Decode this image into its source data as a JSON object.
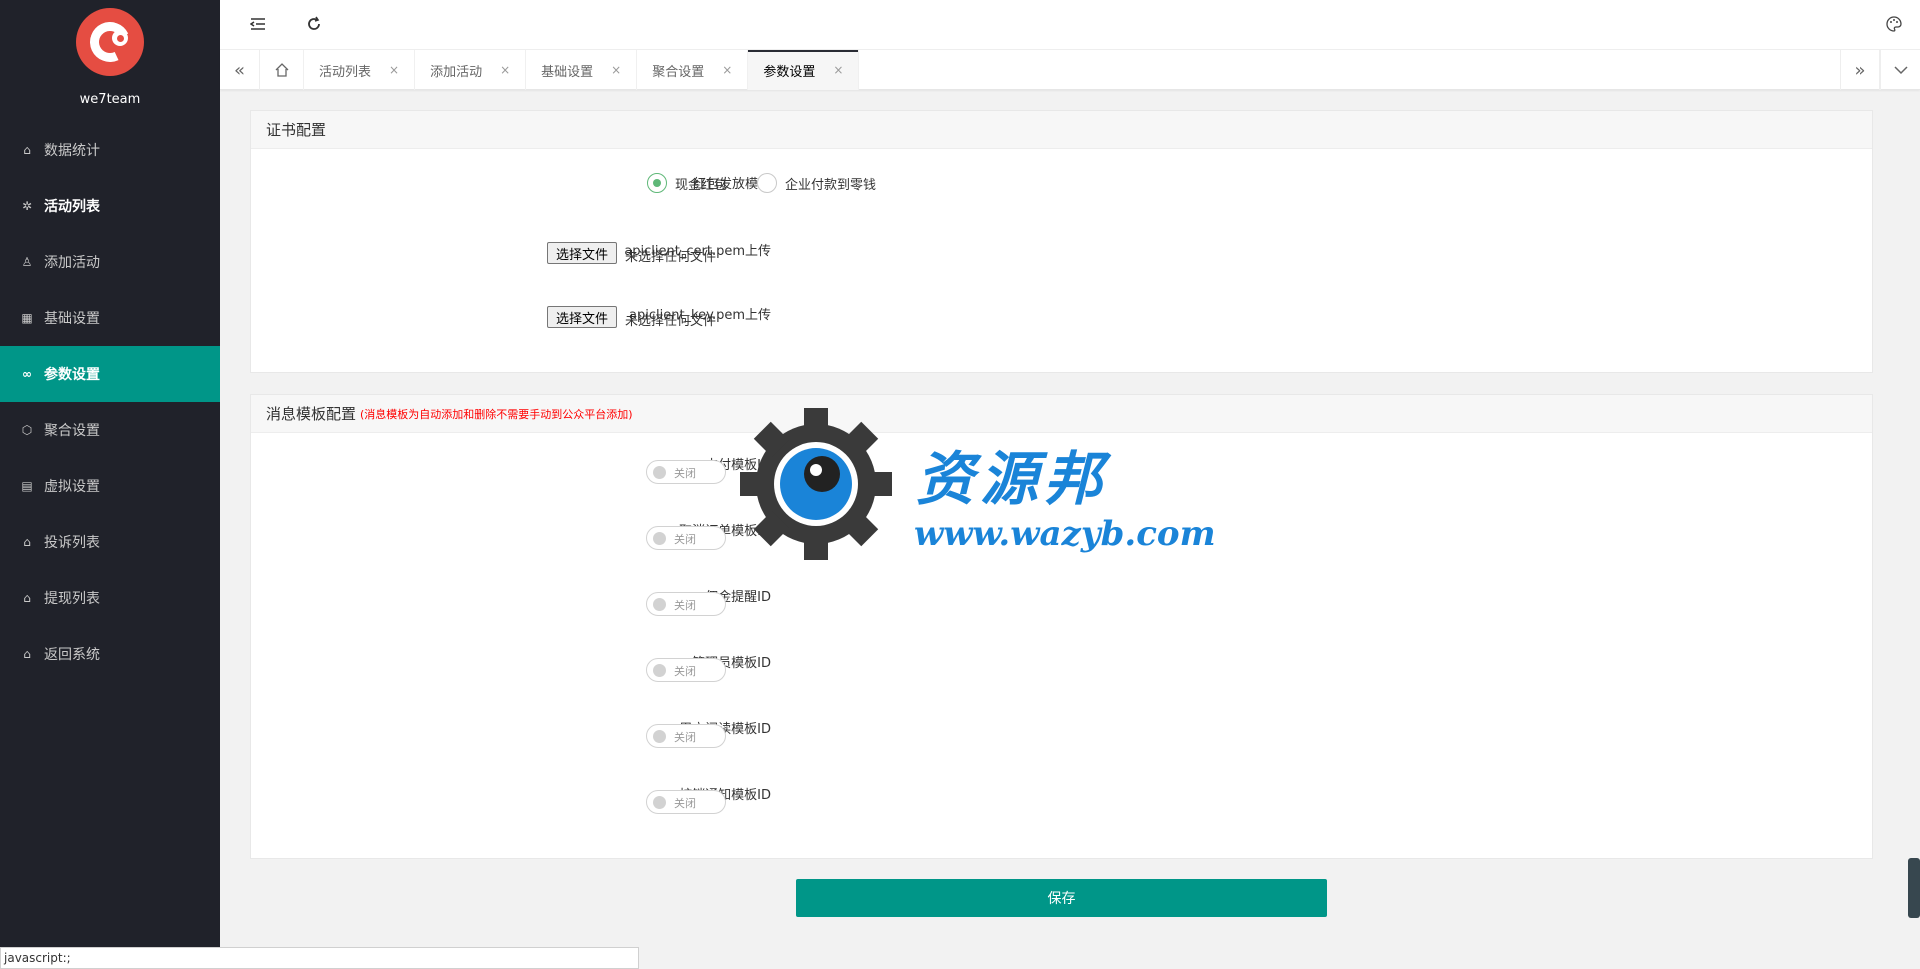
{
  "sidebar": {
    "brand": "we7team",
    "items": [
      {
        "label": "数据统计",
        "icon": "home-icon"
      },
      {
        "label": "活动列表",
        "icon": "gear-icon"
      },
      {
        "label": "添加活动",
        "icon": "user-icon"
      },
      {
        "label": "基础设置",
        "icon": "grid-icon"
      },
      {
        "label": "参数设置",
        "icon": "infinity-icon"
      },
      {
        "label": "聚合设置",
        "icon": "cube-icon"
      },
      {
        "label": "虚拟设置",
        "icon": "book-icon"
      },
      {
        "label": "投诉列表",
        "icon": "home-icon"
      },
      {
        "label": "提现列表",
        "icon": "home-icon"
      },
      {
        "label": "返回系统",
        "icon": "home-icon"
      }
    ],
    "active_index": 4
  },
  "tabs": {
    "items": [
      "活动列表",
      "添加活动",
      "基础设置",
      "聚合设置",
      "参数设置"
    ],
    "close_glyph": "×",
    "active_index": 4
  },
  "cert_card": {
    "title": "证书配置",
    "mode_label": "红包发放模式",
    "mode_options": [
      "现金红包",
      "企业付款到零钱"
    ],
    "mode_selected_index": 0,
    "cert_label": "apiclient_cert.pem上传",
    "key_label": "apiclient_key.pem上传",
    "file_button": "选择文件",
    "file_status": "未选择任何文件"
  },
  "template_card": {
    "title": "消息模板配置",
    "note": "(消息模板为自动添加和删除不需要手动到公众平台添加)",
    "rows": [
      {
        "label": "支付模板ID",
        "state": "关闭"
      },
      {
        "label": "取消订单模板ID",
        "state": "关闭"
      },
      {
        "label": "佣金提醒ID",
        "state": "关闭"
      },
      {
        "label": "管理员模板ID",
        "state": "关闭"
      },
      {
        "label": "用户阅读模板ID",
        "state": "关闭"
      },
      {
        "label": "核销通知模板ID",
        "state": "关闭"
      }
    ]
  },
  "save_label": "保存",
  "watermark": {
    "title": "资源邦",
    "url": "www.wazyb.com"
  },
  "statusbar": "javascript:;",
  "colors": {
    "sidebar_bg": "#20222a",
    "accent": "#009688",
    "radio_on": "#5fb878",
    "note": "#ff0000"
  }
}
